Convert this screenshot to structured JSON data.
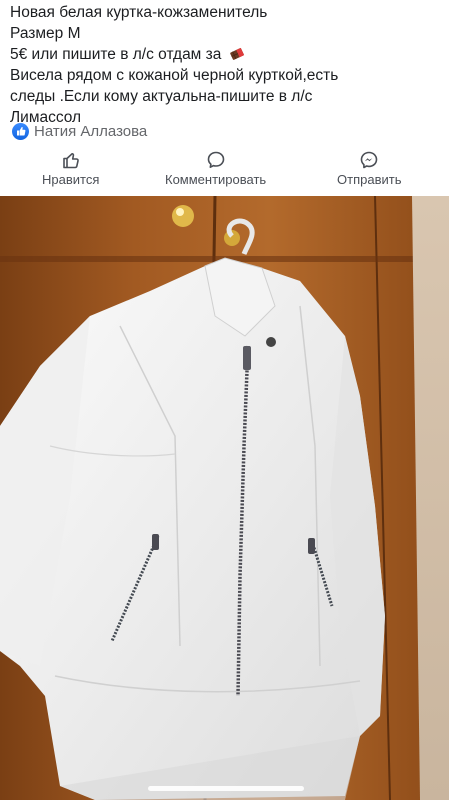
{
  "post": {
    "lines": [
      "Новая белая куртка-кожзаменитель",
      "Размер М",
      " 5€ или пишите в л/с отдам за ",
      "Висела рядом с кожаной черной курткой,есть",
      "следы .Если кому актуальна-пишите в л/с",
      "Лимассол"
    ],
    "emoji": "chocolate-bar-icon"
  },
  "author": {
    "name": "Натия Аллазова"
  },
  "actions": {
    "like": "Нравится",
    "comment": "Комментировать",
    "share": "Отправить"
  },
  "colors": {
    "text": "#1c1e21",
    "muted": "#65676b",
    "like_blue": "#1877f2"
  }
}
